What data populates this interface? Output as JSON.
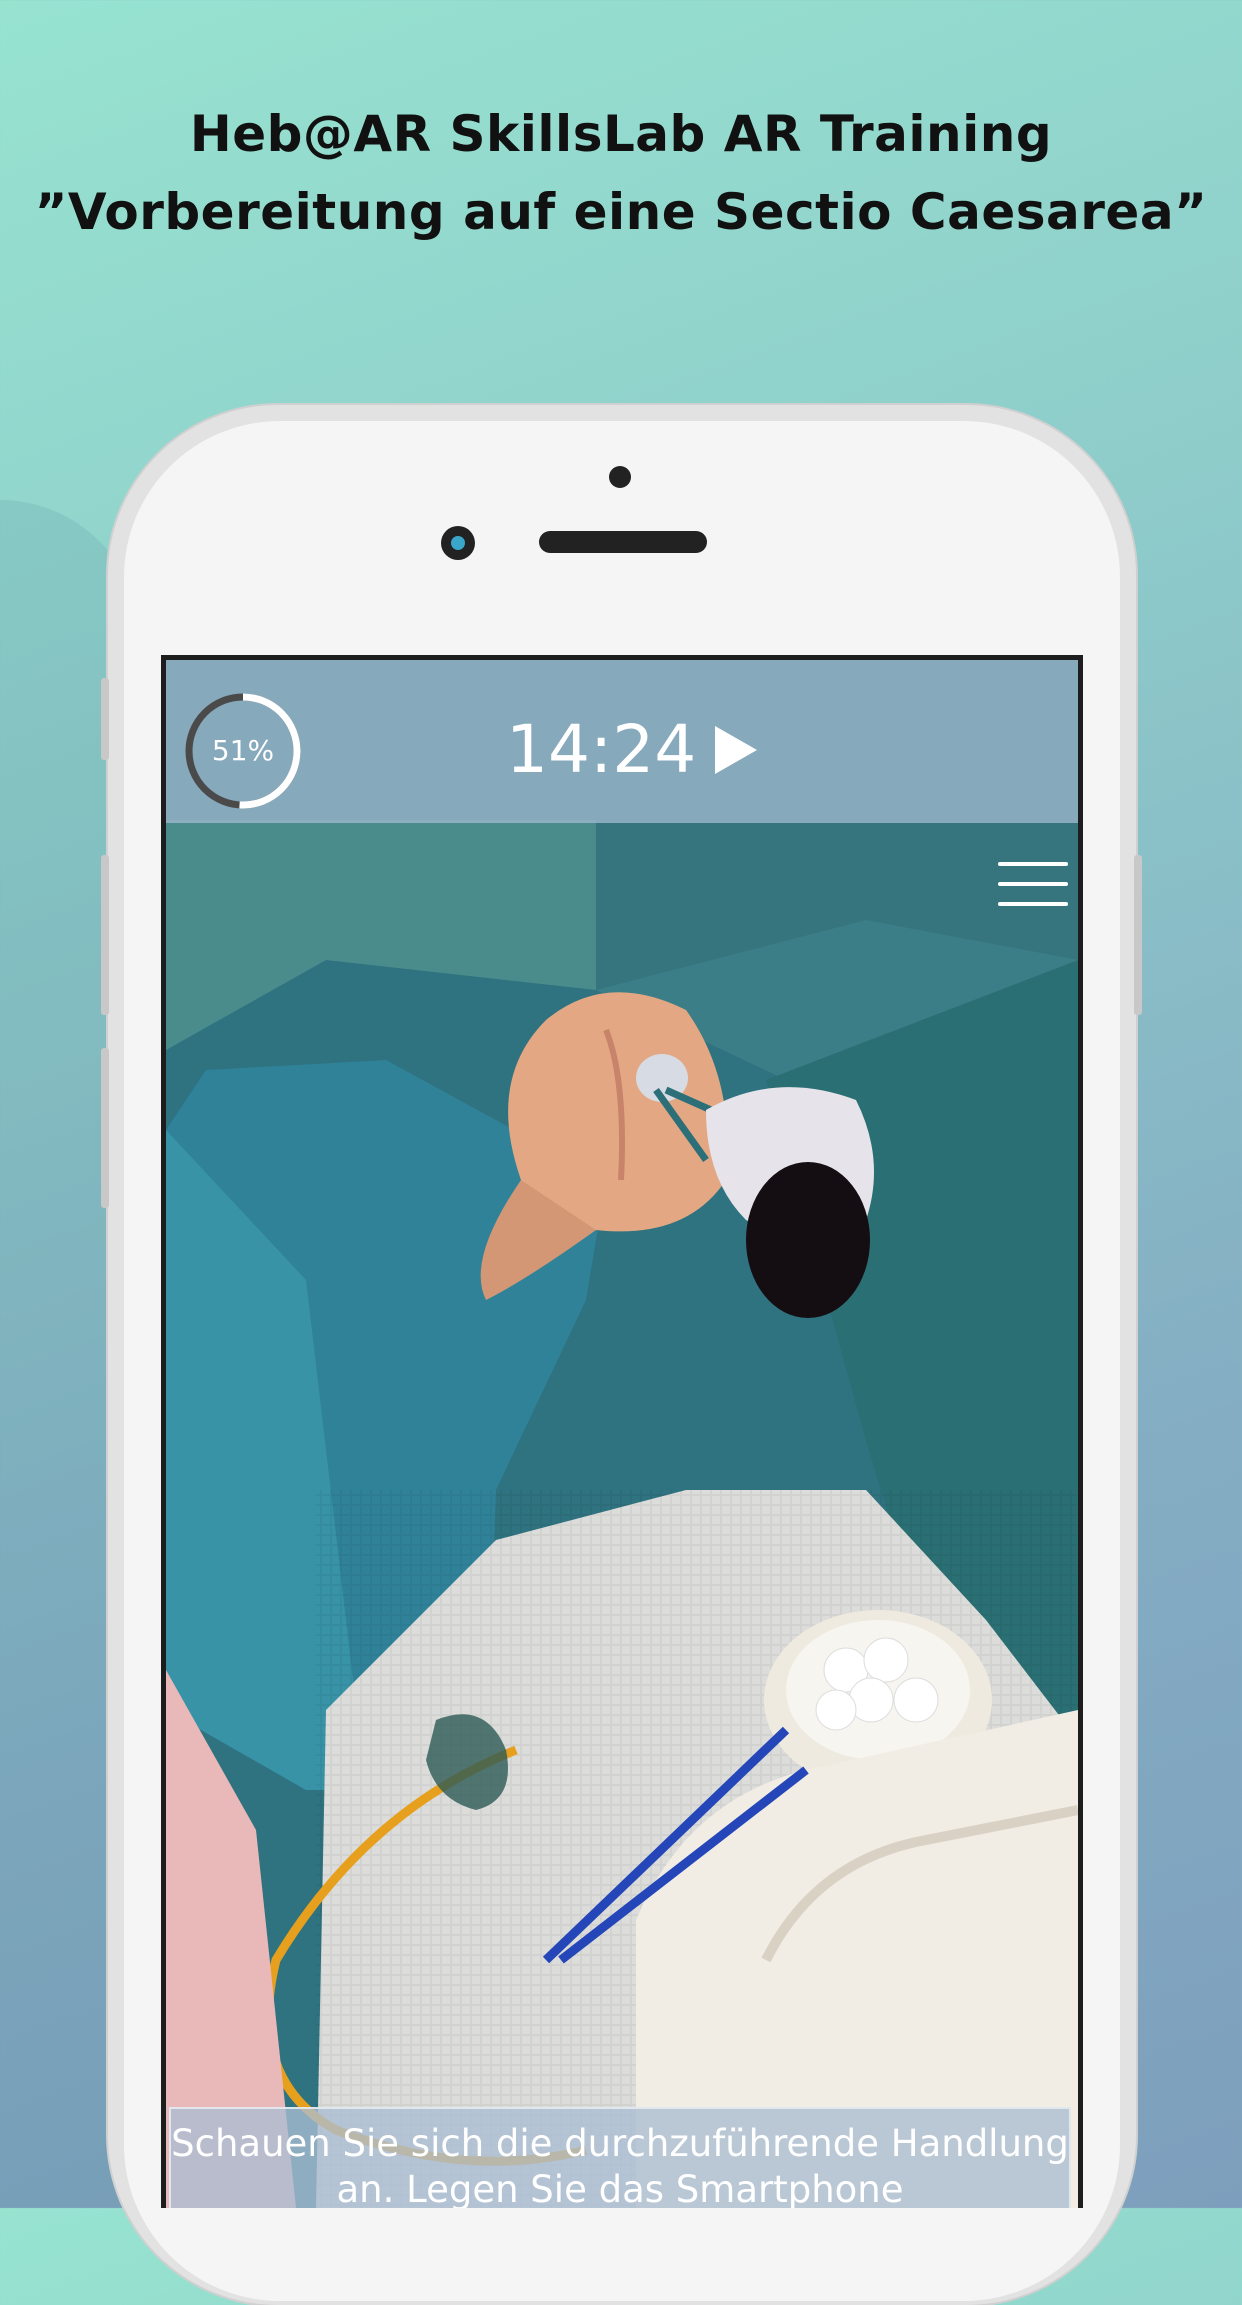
{
  "header": {
    "title_line1": "Heb@AR SkillsLab AR Training",
    "title_line2": "”Vorbereitung auf eine Sectio Caesarea”"
  },
  "ar_overlay": {
    "progress_label": "51%",
    "progress_value": 0.51,
    "timer": "14:24",
    "play_icon": "play-icon",
    "menu_icon": "hamburger-menu-icon",
    "instruction_text": "Schauen Sie sich die durchzuführende Handlung an. Legen Sie das Smartphone"
  },
  "colors": {
    "accent_ring": "#ffffff",
    "overlay": "#a0b9cd"
  }
}
